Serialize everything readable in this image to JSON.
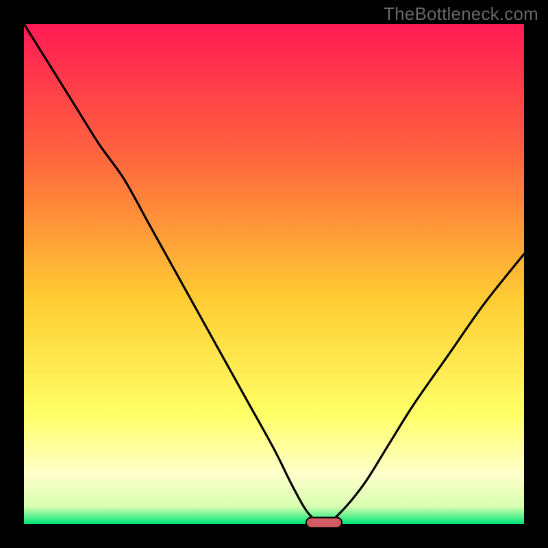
{
  "watermark": "TheBottleneck.com",
  "colors": {
    "bg": "#000000",
    "gradient_top": "#ff1a54",
    "gradient_mid1": "#ff9933",
    "gradient_mid2": "#ffe633",
    "gradient_low": "#ffff99",
    "gradient_green": "#00e676",
    "curve": "#000000",
    "marker_fill": "#d25a62",
    "marker_stroke": "#000000"
  },
  "chart_data": {
    "type": "line",
    "title": "",
    "xlabel": "",
    "ylabel": "",
    "x": [
      0.0,
      0.05,
      0.1,
      0.15,
      0.2,
      0.25,
      0.3,
      0.35,
      0.4,
      0.45,
      0.5,
      0.54,
      0.57,
      0.6,
      0.63,
      0.68,
      0.73,
      0.78,
      0.85,
      0.92,
      1.0
    ],
    "values": [
      100,
      92,
      84,
      76,
      69,
      60,
      51,
      42,
      33,
      24,
      15,
      7,
      2,
      0,
      2,
      8,
      16,
      24,
      34,
      44,
      54
    ],
    "xlim": [
      0,
      1
    ],
    "ylim": [
      0,
      100
    ],
    "optimum_x": 0.6,
    "optimum_y": 0,
    "gradient_stops": [
      {
        "pos": 0.0,
        "color": "#ff1a54"
      },
      {
        "pos": 0.28,
        "color": "#ff6a3d"
      },
      {
        "pos": 0.55,
        "color": "#ffcc33"
      },
      {
        "pos": 0.78,
        "color": "#ffff66"
      },
      {
        "pos": 0.9,
        "color": "#ffffcc"
      },
      {
        "pos": 0.965,
        "color": "#d8ffb0"
      },
      {
        "pos": 1.0,
        "color": "#00e676"
      }
    ]
  }
}
